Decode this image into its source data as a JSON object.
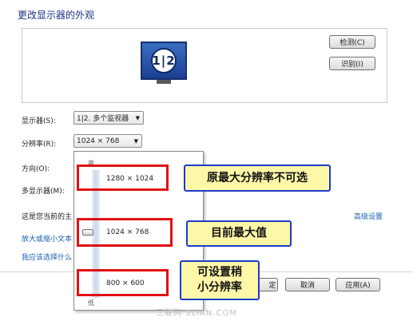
{
  "page": {
    "title": "更改显示器的外观"
  },
  "preview": {
    "monitor_number": "1|2",
    "detect_button": "检测(C)",
    "identify_button": "识别(I)"
  },
  "form": {
    "display_label": "显示器(S):",
    "display_value": "1|2. 多个监视器",
    "resolution_label": "分辨率(R):",
    "resolution_value": "1024 × 768",
    "orientation_label": "方向(O):",
    "multi_display_label": "多显示器(M):",
    "current_display_text": "这是您当前的主",
    "advanced_link": "高级设置",
    "enlarge_link": "放大或缩小文本",
    "choose_link": "我应该选择什么"
  },
  "dropdown": {
    "high_label": "高",
    "low_label": "低",
    "options": [
      "1280 × 1024",
      "1024 × 768",
      "800 × 600"
    ],
    "current_level": 0.5
  },
  "footer": {
    "ok_fragment": "定",
    "cancel_button": "取消",
    "apply_button": "应用(A)"
  },
  "annotations": {
    "max_unavailable": "原最大分辨率不可选",
    "current_max": "目前最大值",
    "smaller_line1": "可设置稍",
    "smaller_line2": "小分辨率"
  },
  "watermark": "三联网 3LIAN.COM",
  "colors": {
    "title": "#1e3287",
    "link": "#1a5fb4",
    "annotation_fill": "#fff7a8",
    "annotation_border": "#1a3cc8",
    "highlight_red": "#e01010"
  }
}
